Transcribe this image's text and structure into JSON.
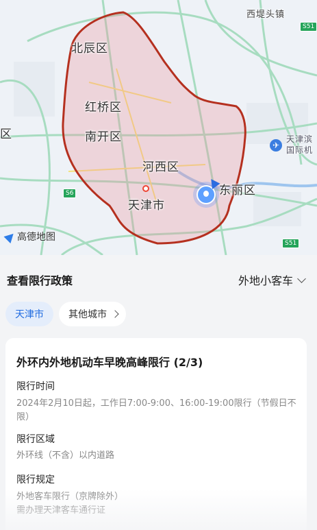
{
  "map": {
    "districts": {
      "beichen": "北辰区",
      "hongqiao": "红桥区",
      "nankai": "南开区",
      "hexi": "河西区",
      "city": "天津市",
      "dongli": "东丽区",
      "left_edge": "区"
    },
    "places": {
      "xidi": "西堤头镇",
      "airport_line1": "天津滨",
      "airport_line2": "国际机"
    },
    "road_badges": [
      "S51",
      "S6",
      "S51"
    ],
    "logo": "高德地图",
    "boundary_color": "#c0392b"
  },
  "sheet": {
    "title": "查看限行政策",
    "vehicle_type": "外地小客车",
    "city_tabs": {
      "active": "天津市",
      "other": "其他城市"
    },
    "policy": {
      "title": "外环内外地机动车早晚高峰限行 (2/3)",
      "time_label": "限行时间",
      "time_value": "2024年2月10日起，工作日7:00-9:00、16:00-19:00限行（节假日不限）",
      "area_label": "限行区域",
      "area_value": "外环线（不含）以内道路",
      "rule_label": "限行规定",
      "rule_value_1": "外地客车限行（京牌除外）",
      "rule_value_2": "需办理天津客车通行证"
    }
  },
  "colors": {
    "accent": "#1f6be0",
    "chip_active_bg": "#e4edfb"
  }
}
